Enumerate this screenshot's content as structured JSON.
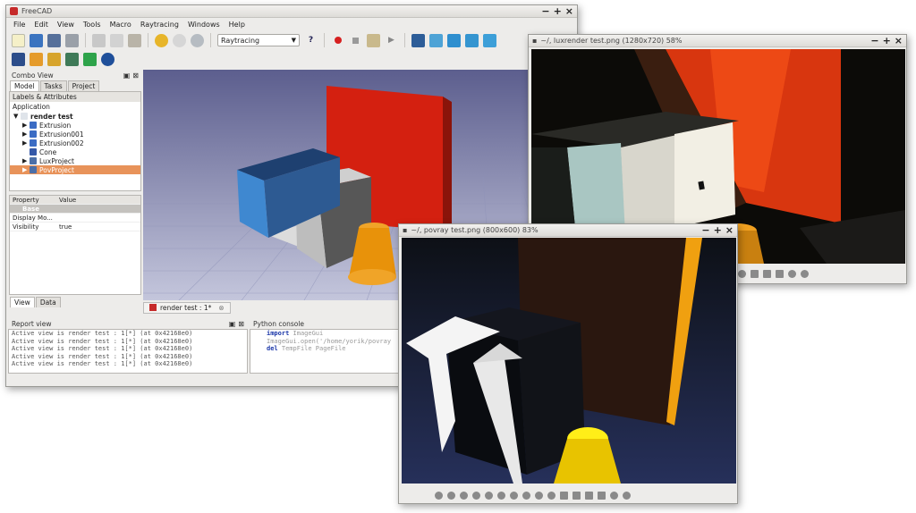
{
  "main": {
    "title": "FreeCAD",
    "menu": [
      "File",
      "Edit",
      "View",
      "Tools",
      "Macro",
      "Raytracing",
      "Windows",
      "Help"
    ],
    "workbench": "Raytracing",
    "combo_title": "Combo View",
    "tabs": [
      "Model",
      "Tasks",
      "Project"
    ],
    "labels_title": "Labels & Attributes",
    "application": "Application",
    "tree": [
      {
        "label": "render test",
        "level": 0,
        "bold": true,
        "icon": "document-icon"
      },
      {
        "label": "Extrusion",
        "level": 1,
        "icon": "extrusion-icon"
      },
      {
        "label": "Extrusion001",
        "level": 1,
        "icon": "extrusion-icon"
      },
      {
        "label": "Extrusion002",
        "level": 1,
        "icon": "extrusion-icon"
      },
      {
        "label": "Cone",
        "level": 1,
        "icon": "cone-icon"
      },
      {
        "label": "LuxProject",
        "level": 1,
        "icon": "project-icon"
      },
      {
        "label": "PovProject",
        "level": 1,
        "icon": "project-icon",
        "selected": true
      }
    ],
    "prop_headers": [
      "Property",
      "Value"
    ],
    "prop_group": "Base",
    "props": [
      {
        "name": "Display Mo...",
        "value": ""
      },
      {
        "name": "Visibility",
        "value": "true"
      }
    ],
    "bottom_tabs": [
      "View",
      "Data"
    ],
    "doc_tab": "render test : 1*",
    "report_title": "Report view",
    "report_lines": [
      "Active view is render test : 1[*] (at 0x42168e0)",
      "Active view is render test : 1[*] (at 0x42168e0)",
      "Active view is render test : 1[*] (at 0x42168e0)",
      "Active view is render test : 1[*] (at 0x42168e0)",
      "Active view is render test : 1[*] (at 0x42168e0)"
    ],
    "python_title": "Python console",
    "python_lines": [
      {
        "kw": "import",
        "rest": " ImageGui"
      },
      {
        "kw": "",
        "rest": "ImageGui.open('/home/yorik/povray"
      },
      {
        "kw": "del",
        "rest": " TempFile PageFile"
      }
    ]
  },
  "lux": {
    "title": "~/, luxrender test.png (1280x720) 58%"
  },
  "pov": {
    "title": "~/, povray test.png (800x600) 83%"
  },
  "colors": {
    "accent": "#f0a060",
    "selected": "#e8935a"
  }
}
